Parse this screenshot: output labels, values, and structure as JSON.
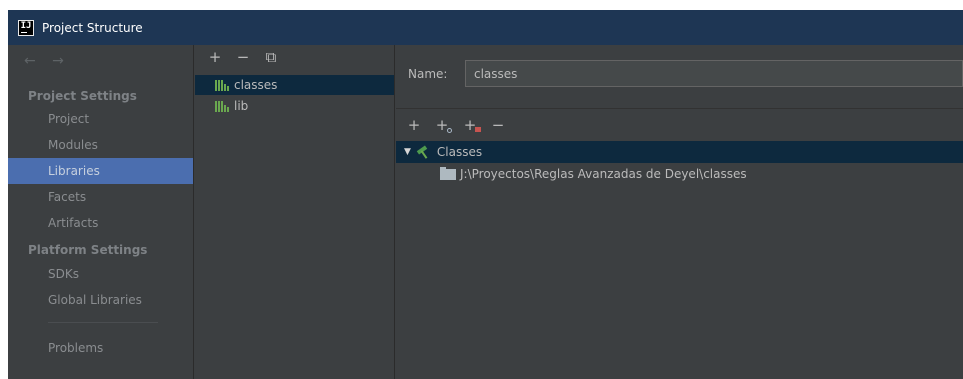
{
  "window": {
    "title": "Project Structure",
    "app_icon_text": "IJ"
  },
  "nav": {
    "back_forward": "← →",
    "project_settings_header": "Project Settings",
    "items_project": [
      "Project",
      "Modules",
      "Libraries",
      "Facets",
      "Artifacts"
    ],
    "platform_settings_header": "Platform Settings",
    "items_platform": [
      "SDKs",
      "Global Libraries"
    ],
    "problems": "Problems",
    "selected": "Libraries"
  },
  "libraries": {
    "toolbar": {
      "add": "+",
      "remove": "−",
      "copy": "⧉"
    },
    "items": [
      "classes",
      "lib"
    ],
    "selected": "classes"
  },
  "detail": {
    "name_label": "Name:",
    "name_value": "classes",
    "toolbar": {
      "add": "+",
      "add_with_badge": "+",
      "add_folder": "+",
      "remove": "−"
    },
    "tree": {
      "root_label": "Classes",
      "child_path": "J:\\Proyectos\\Reglas Avanzadas de Deyel\\classes"
    }
  },
  "colors": {
    "title_bar": "#1e3654",
    "panel_bg": "#3c3f41",
    "nav_selected": "#4b6eaf",
    "list_selected": "#0d293e",
    "library_icon": "#6aa84f"
  }
}
